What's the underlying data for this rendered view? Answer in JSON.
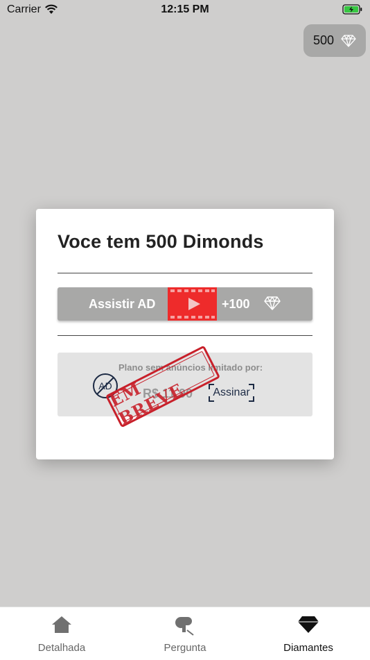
{
  "status_bar": {
    "carrier": "Carrier",
    "time": "12:15 PM"
  },
  "balance": {
    "value": "500",
    "icon": "diamond-icon"
  },
  "modal": {
    "title": "Voce tem 500 Dimonds",
    "watch_ad": {
      "label": "Assistir AD",
      "reward": "+100",
      "icon": "video-play-icon"
    },
    "premium": {
      "description": "Plano sem anúncios limitado por:",
      "price": "R$ 11,90",
      "subscribe_label": "Assinar",
      "stamp_text": "EM BREVE",
      "icon": "no-ads-icon"
    }
  },
  "tabs": [
    {
      "label": "Detalhada",
      "icon": "home-icon",
      "active": false
    },
    {
      "label": "Pergunta",
      "icon": "question-icon",
      "active": false
    },
    {
      "label": "Diamantes",
      "icon": "diamond-icon",
      "active": true
    }
  ],
  "colors": {
    "accent_red": "#ee2b2b",
    "stamp_red": "#c8202a",
    "button_gray": "#a8a8a7",
    "backdrop": "#cfcecd"
  }
}
